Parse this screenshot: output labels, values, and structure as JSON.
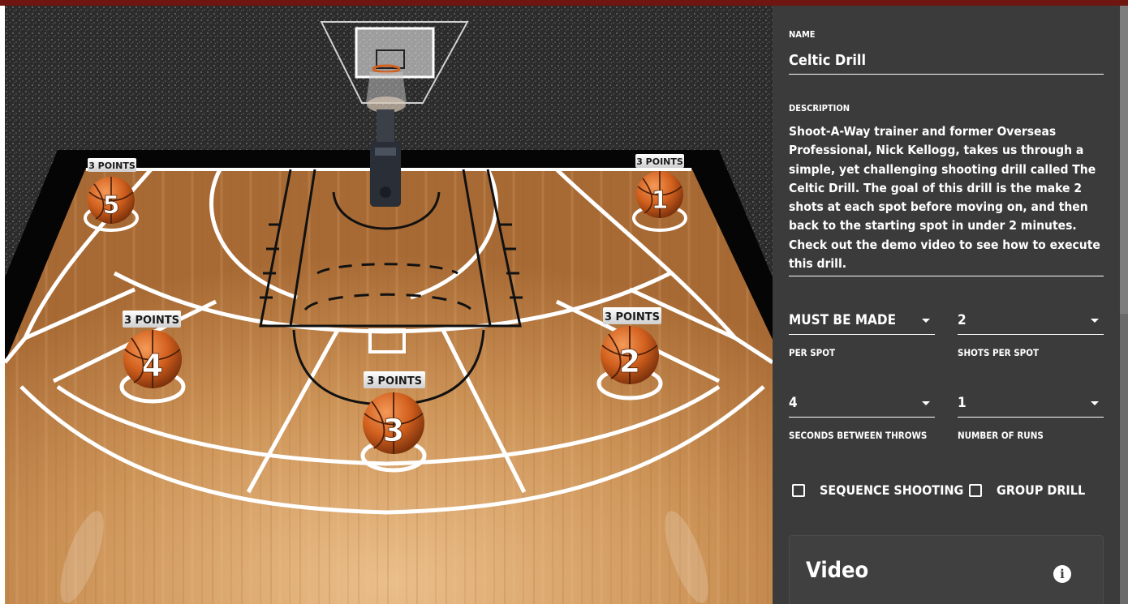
{
  "court": {
    "spots": [
      {
        "number": "5",
        "points_label": "3 POINTS"
      },
      {
        "number": "1",
        "points_label": "3 POINTS"
      },
      {
        "number": "4",
        "points_label": "3 POINTS"
      },
      {
        "number": "2",
        "points_label": "3 POINTS"
      },
      {
        "number": "3",
        "points_label": "3 POINTS"
      }
    ]
  },
  "form": {
    "name_label": "NAME",
    "name_value": "Celtic Drill",
    "description_label": "DESCRIPTION",
    "description_text": "Shoot-A-Way trainer and former Overseas Professional, Nick Kellogg, takes us through a simple, yet challenging shooting drill called The Celtic Drill. The goal of this drill is the make 2 shots at each spot before moving on, and then back to the starting spot in under 2 minutes. Check out the demo video to see how to execute this drill.",
    "selects": {
      "per_spot": {
        "value": "MUST BE MADE",
        "caption": "PER SPOT"
      },
      "shots_per_spot": {
        "value": "2",
        "caption": "SHOTS PER SPOT"
      },
      "seconds_between_throws": {
        "value": "4",
        "caption": "SECONDS BETWEEN THROWS"
      },
      "number_of_runs": {
        "value": "1",
        "caption": "NUMBER OF RUNS"
      }
    },
    "checkboxes": {
      "sequence_shooting": {
        "label": "SEQUENCE SHOOTING",
        "checked": false
      },
      "group_drill": {
        "label": "GROUP DRILL",
        "checked": false
      }
    },
    "video_card": {
      "title": "Video",
      "icon": "info-icon"
    }
  },
  "colors": {
    "top_strip": "#6e160f",
    "panel_bg": "#3b3b3b",
    "court_wood": "#c48a4e",
    "ball": "#d2601e"
  }
}
